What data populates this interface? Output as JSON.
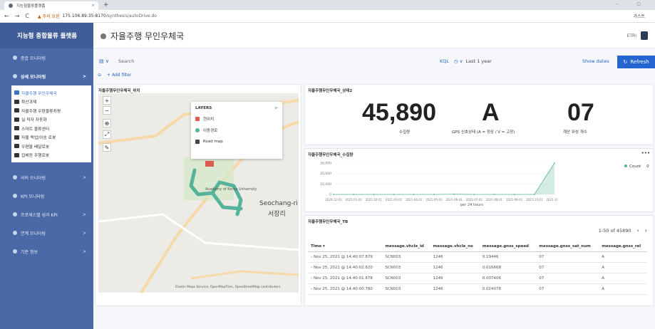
{
  "browser": {
    "tab_title": "지능형물류플랫폼",
    "tab_close": "×",
    "new_tab": "+",
    "window_controls": "– ▢",
    "back": "←",
    "forward": "→",
    "reload": "C",
    "security": "▲ 주의 요함",
    "url_host": "175.106.89.35:8170",
    "url_path": "/synthesis/autoDrive.do",
    "profile": "가스트"
  },
  "sidebar": {
    "brand": "지능형 종합물류 플랫폼",
    "menu": [
      {
        "label": "종합 모니터링"
      },
      {
        "label": "상세 모니터링",
        "arrow": ">"
      },
      {
        "label": "서비 모니터링",
        "arrow": ">"
      },
      {
        "label": "KPI 모니터링"
      },
      {
        "label": "프로세스별 성과 KPI",
        "arrow": ">"
      },
      {
        "label": "연계 모니터링",
        "arrow": ">"
      },
      {
        "label": "기준 정보",
        "arrow": ">"
      }
    ],
    "submenu": [
      "자율주행 무인우체국",
      "확산과제",
      "자율주행 우편물류차량",
      "실 적자 자동화",
      "스마트 물류센터",
      "자율 택업/이송 로봇",
      "우편물 배달로봇",
      "집배원 주행로봇"
    ]
  },
  "header": {
    "title": "자율주행 무인우체국",
    "user": "ETRI"
  },
  "query": {
    "search_placeholder": "Search",
    "kql": "KQL",
    "time": "Last 1 year",
    "show_dates": "Show dates",
    "refresh": "Refresh",
    "add_filter": "+ Add filter"
  },
  "map_panel": {
    "title": "자율주행무인우체국_위치",
    "layers": {
      "heading": "LAYERS",
      "items": [
        "현위치",
        "이동경로",
        "Road map"
      ],
      "colors": [
        "#e05b4f",
        "#54b399",
        "#444444"
      ]
    },
    "labels": {
      "district": "Seochang-ri",
      "district_ko": "서장리",
      "campus": "Academy of Korea University",
      "attribution": "Elastic Maps Service, OpenMapTiles, OpenStreetMap contributors"
    }
  },
  "status_panel": {
    "title": "자율주행무인우체국_상태2",
    "metrics": [
      {
        "value": "45,890",
        "label": "수집량"
      },
      {
        "value": "A",
        "label": "GPS 신호상태 (A = 정상 / V = 고장)"
      },
      {
        "value": "07",
        "label": "계산 위성 개수"
      }
    ]
  },
  "collection_panel": {
    "title": "자율주행무인우체국_수집량",
    "legend": "Count",
    "legend_value": "0",
    "x_axis_label": "per 24 hours"
  },
  "chart_data": {
    "type": "area",
    "title": "자율주행무인우체국_수집량",
    "xlabel": "per 24 hours",
    "ylabel": "",
    "series": [
      {
        "name": "Count",
        "color": "#54b399",
        "x": [
          "2020-12-01",
          "2021-01-01",
          "2021-02-01",
          "2021-03-01",
          "2021-04-01",
          "2021-05-01",
          "2021-06-01",
          "2021-07-01",
          "2021-08-01",
          "2021-09-01",
          "2021-10-01",
          "2021-11-01"
        ],
        "values": [
          0,
          0,
          0,
          0,
          0,
          0,
          200,
          0,
          0,
          0,
          0,
          30000
        ]
      }
    ],
    "y_ticks": [
      "30,000",
      "20,000",
      "10,000",
      "0"
    ],
    "ylim": [
      0,
      30000
    ],
    "grid": true,
    "legend_position": "right"
  },
  "table_panel": {
    "title": "자율주행무인우체국_TB",
    "pagination": "1-50 of 45890",
    "columns": [
      "Time",
      "message.vhcle_id",
      "message.vhcle_no",
      "message.gnss_speed",
      "message.gnss_sat_num",
      "message.gnss_rel"
    ],
    "rows": [
      [
        "Nov 25, 2021 @ 14:40:07.879",
        "SCN003",
        "1246",
        "0.19446",
        "07",
        "A"
      ],
      [
        "Nov 25, 2021 @ 14:40:02.820",
        "SCN003",
        "1246",
        "0.016668",
        "07",
        "A"
      ],
      [
        "Nov 25, 2021 @ 14:40:01.878",
        "SCN003",
        "1246",
        "0.007406",
        "07",
        "A"
      ],
      [
        "Nov 25, 2021 @ 14:40:00.780",
        "SCN003",
        "1246",
        "0.024078",
        "07",
        "A"
      ]
    ]
  }
}
